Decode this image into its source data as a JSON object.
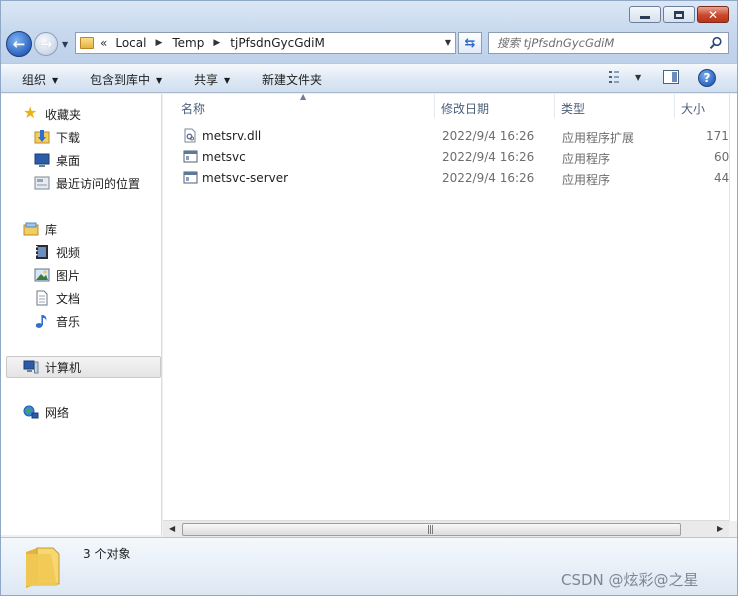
{
  "window": {
    "caption": {
      "minimize": "minimize",
      "maximize": "maximize",
      "close": "✕"
    }
  },
  "nav": {
    "back": "←",
    "forward": "→",
    "breadcrumb_lead": "«",
    "breadcrumb": [
      "Local",
      "Temp",
      "tjPfsdnGycGdiM"
    ],
    "search_placeholder": "搜索 tjPfsdnGycGdiM"
  },
  "toolbar": {
    "organize": "组织",
    "include_in_library": "包含到库中",
    "share": "共享",
    "new_folder": "新建文件夹",
    "help": "?"
  },
  "sidebar": {
    "favorites": {
      "label": "收藏夹",
      "items": [
        {
          "label": "下载",
          "icon": "download-folder-icon"
        },
        {
          "label": "桌面",
          "icon": "desktop-icon"
        },
        {
          "label": "最近访问的位置",
          "icon": "recent-places-icon"
        }
      ]
    },
    "libraries": {
      "label": "库",
      "items": [
        {
          "label": "视频",
          "icon": "video-icon"
        },
        {
          "label": "图片",
          "icon": "picture-icon"
        },
        {
          "label": "文档",
          "icon": "document-icon"
        },
        {
          "label": "音乐",
          "icon": "music-icon"
        }
      ]
    },
    "computer": {
      "label": "计算机"
    },
    "network": {
      "label": "网络"
    }
  },
  "file_list": {
    "columns": {
      "name": "名称",
      "modified": "修改日期",
      "type": "类型",
      "size": "大小"
    },
    "rows": [
      {
        "name": "metsrv.dll",
        "modified": "2022/9/4 16:26",
        "type": "应用程序扩展",
        "size": "171",
        "icon": "dll-file-icon"
      },
      {
        "name": "metsvc",
        "modified": "2022/9/4 16:26",
        "type": "应用程序",
        "size": "60",
        "icon": "exe-file-icon"
      },
      {
        "name": "metsvc-server",
        "modified": "2022/9/4 16:26",
        "type": "应用程序",
        "size": "44",
        "icon": "exe-file-icon"
      }
    ]
  },
  "scroll": {
    "left": "◀",
    "right": "▶",
    "grip": "|||"
  },
  "details": {
    "count": "3 个对象"
  },
  "watermark": "CSDN @炫彩@之星",
  "colors": {
    "accent": "#2c64c2",
    "selected_nav": "#e4e4e4",
    "header_text": "#4c607a"
  }
}
